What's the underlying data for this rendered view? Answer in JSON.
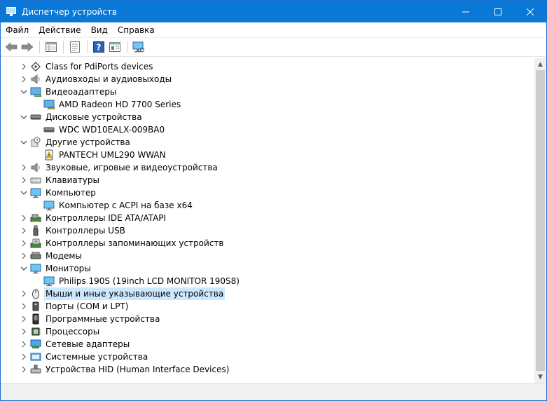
{
  "window": {
    "title": "Диспетчер устройств",
    "accent": "#0a78d7"
  },
  "menu": [
    "Файл",
    "Действие",
    "Вид",
    "Справка"
  ],
  "toolbar_icons": [
    "back-arrow-icon",
    "forward-arrow-icon",
    "properties-grid-icon",
    "list-view-icon",
    "help-icon",
    "view-panel-icon",
    "scan-hardware-icon"
  ],
  "tree": [
    {
      "label": "Class for PdiPorts devices",
      "level": 0,
      "expand": "collapsed",
      "icon": "pdiports-icon"
    },
    {
      "label": "Аудиовходы и аудиовыходы",
      "level": 0,
      "expand": "collapsed",
      "icon": "speaker-icon"
    },
    {
      "label": "Видеоадаптеры",
      "level": 0,
      "expand": "expanded",
      "icon": "display-adapter-icon"
    },
    {
      "label": "AMD Radeon HD 7700 Series",
      "level": 1,
      "expand": "none",
      "icon": "display-adapter-icon"
    },
    {
      "label": "Дисковые устройства",
      "level": 0,
      "expand": "expanded",
      "icon": "disk-drive-icon"
    },
    {
      "label": "WDC WD10EALX-009BA0",
      "level": 1,
      "expand": "none",
      "icon": "disk-drive-icon"
    },
    {
      "label": "Другие устройства",
      "level": 0,
      "expand": "expanded",
      "icon": "unknown-device-icon"
    },
    {
      "label": "PANTECH UML290 WWAN",
      "level": 1,
      "expand": "none",
      "icon": "warning-device-icon"
    },
    {
      "label": "Звуковые, игровые и видеоустройства",
      "level": 0,
      "expand": "collapsed",
      "icon": "speaker-icon"
    },
    {
      "label": "Клавиатуры",
      "level": 0,
      "expand": "collapsed",
      "icon": "keyboard-icon"
    },
    {
      "label": "Компьютер",
      "level": 0,
      "expand": "expanded",
      "icon": "monitor-icon"
    },
    {
      "label": "Компьютер с ACPI на базе x64",
      "level": 1,
      "expand": "none",
      "icon": "monitor-icon"
    },
    {
      "label": "Контроллеры IDE ATA/ATAPI",
      "level": 0,
      "expand": "collapsed",
      "icon": "ide-controller-icon"
    },
    {
      "label": "Контроллеры USB",
      "level": 0,
      "expand": "collapsed",
      "icon": "usb-icon"
    },
    {
      "label": "Контроллеры запоминающих устройств",
      "level": 0,
      "expand": "collapsed",
      "icon": "storage-controller-icon"
    },
    {
      "label": "Модемы",
      "level": 0,
      "expand": "collapsed",
      "icon": "modem-icon"
    },
    {
      "label": "Мониторы",
      "level": 0,
      "expand": "expanded",
      "icon": "monitor-icon"
    },
    {
      "label": "Philips 190S (19inch LCD MONITOR 190S8)",
      "level": 1,
      "expand": "none",
      "icon": "monitor-icon"
    },
    {
      "label": "Мыши и иные указывающие устройства",
      "level": 0,
      "expand": "collapsed",
      "icon": "mouse-icon",
      "selected": true
    },
    {
      "label": "Порты (COM и LPT)",
      "level": 0,
      "expand": "collapsed",
      "icon": "port-icon"
    },
    {
      "label": "Программные устройства",
      "level": 0,
      "expand": "collapsed",
      "icon": "software-device-icon"
    },
    {
      "label": "Процессоры",
      "level": 0,
      "expand": "collapsed",
      "icon": "processor-icon"
    },
    {
      "label": "Сетевые адаптеры",
      "level": 0,
      "expand": "collapsed",
      "icon": "network-adapter-icon"
    },
    {
      "label": "Системные устройства",
      "level": 0,
      "expand": "collapsed",
      "icon": "system-device-icon"
    },
    {
      "label": "Устройства HID (Human Interface Devices)",
      "level": 0,
      "expand": "collapsed",
      "icon": "hid-icon"
    }
  ]
}
